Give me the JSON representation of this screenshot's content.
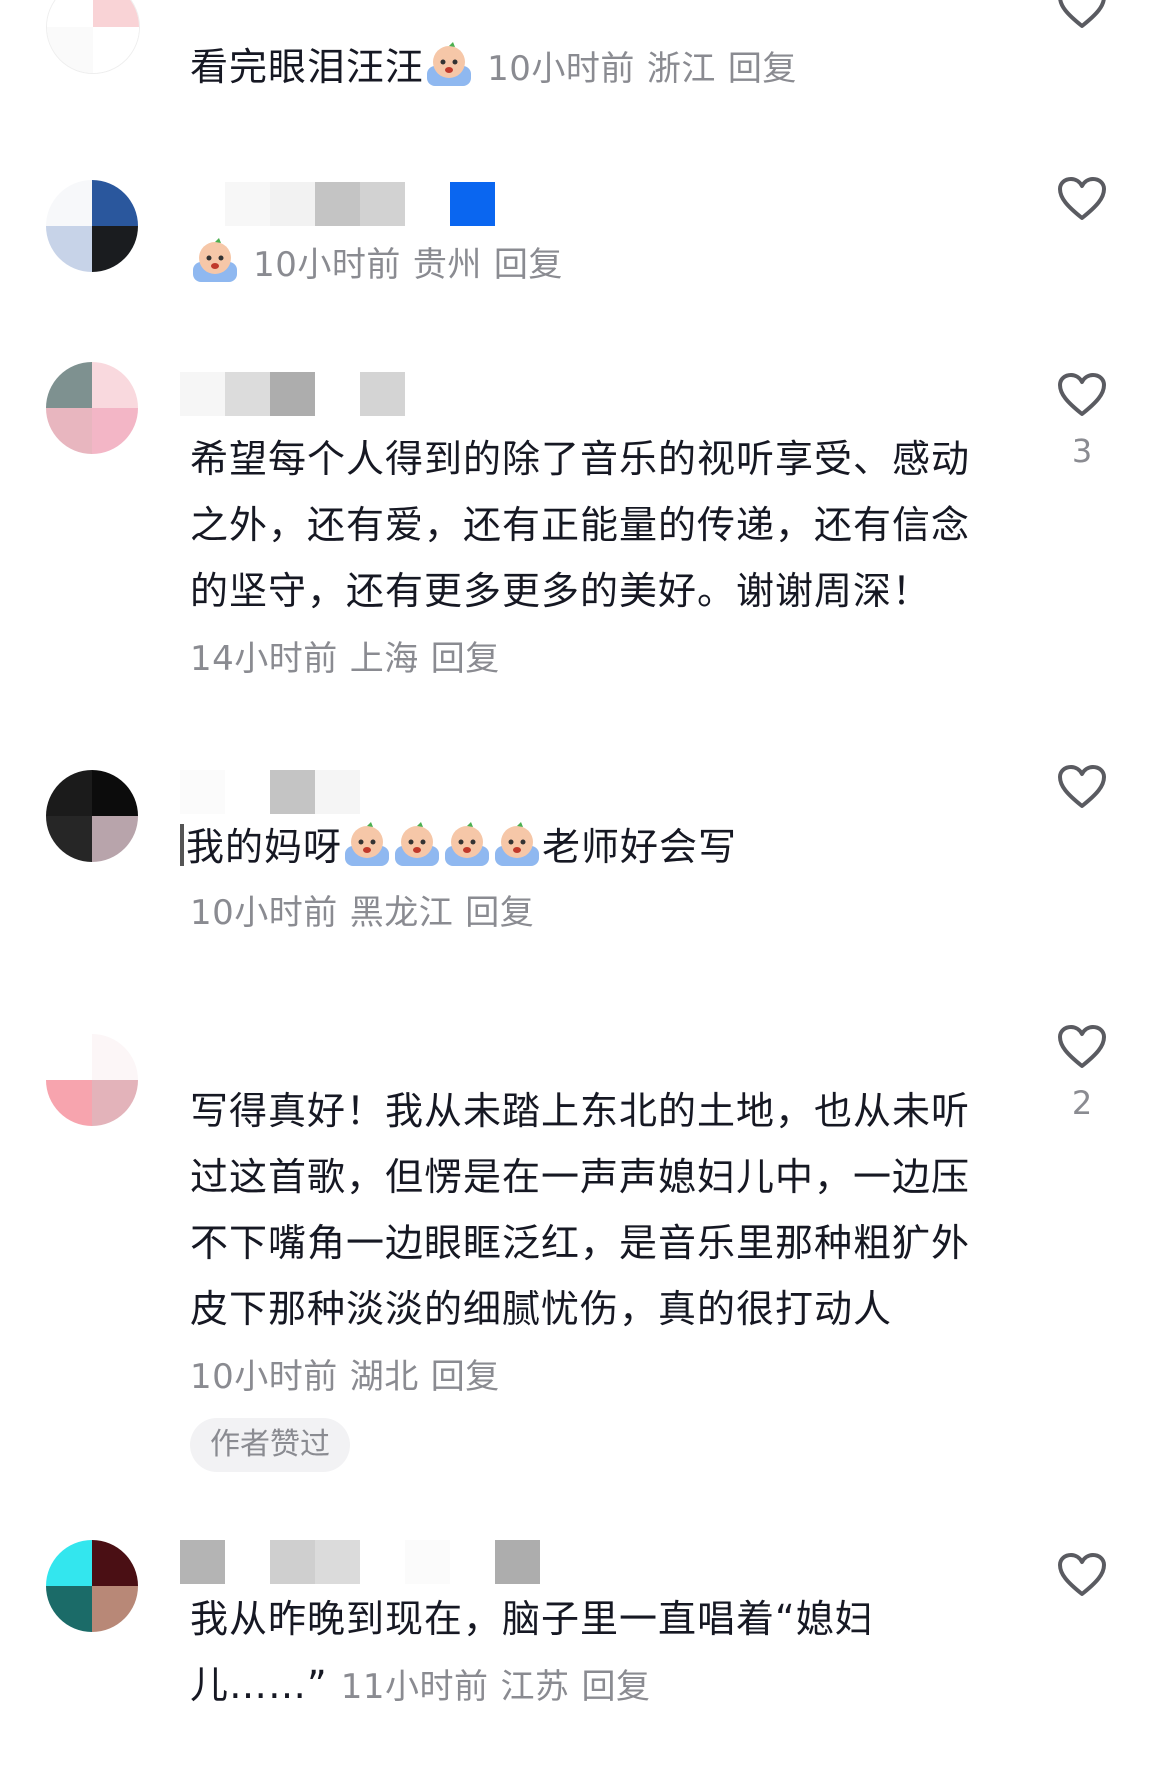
{
  "comments": [
    {
      "text": "看完眼泪汪汪",
      "emoji_count": 1,
      "time": "10小时前",
      "location": "浙江",
      "reply": "回复",
      "likes": ""
    },
    {
      "text": "",
      "emoji_count": 1,
      "time": "10小时前",
      "location": "贵州",
      "reply": "回复",
      "likes": ""
    },
    {
      "text": "希望每个人得到的除了音乐的视听享受、感动之外，还有爱，还有正能量的传递，还有信念的坚守，还有更多更多的美好。谢谢周深！",
      "time": "14小时前",
      "location": "上海",
      "reply": "回复",
      "likes": "3"
    },
    {
      "text_before": "我的妈呀",
      "emoji_count": 4,
      "text_after": "老师好会写",
      "time": "10小时前",
      "location": "黑龙江",
      "reply": "回复",
      "likes": ""
    },
    {
      "text": "写得真好！我从未踏上东北的土地，也从未听过这首歌，但愣是在一声声媳妇儿中，一边压不下嘴角一边眼眶泛红，是音乐里那种粗犷外皮下那种淡淡的细腻忧伤，真的很打动人",
      "time": "10小时前",
      "location": "湖北",
      "reply": "回复",
      "likes": "2",
      "badge": "作者赞过"
    },
    {
      "text": "我从昨晚到现在，脑子里一直唱着“媳妇儿……”",
      "time": "11小时前",
      "location": "江苏",
      "reply": "回复",
      "likes": ""
    }
  ],
  "colors": {
    "text": "#161823",
    "meta": "#8a8b91",
    "badge_bg": "#f2f2f4",
    "emoji_face": "#f6c7a8",
    "emoji_tear": "#8fb8f0"
  },
  "icons": {
    "like": "heart-outline-icon",
    "emoji": "crying-emoji-icon"
  }
}
